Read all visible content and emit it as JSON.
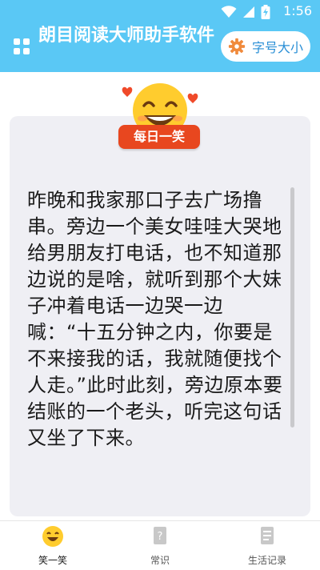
{
  "status_bar": {
    "time": "1:56",
    "battery_icon": "battery-charging-icon",
    "wifi_icon": "wifi-icon",
    "signal_icon": "signal-icon"
  },
  "header": {
    "menu_icon": "grid-menu-icon",
    "title": "朗目阅读大师助手软件",
    "font_size_button": {
      "icon": "gear-icon",
      "label": "字号大小"
    }
  },
  "joke_card": {
    "badge": "每日一笑",
    "emoji_icon": "laughing-face-icon",
    "text": "昨晚和我家那口子去广场撸串。旁边一个美女哇哇大哭地给男朋友打电话，也不知道那边说的是啥，就听到那个大妹子冲着电话一边哭一边喊：“十五分钟之内，你要是不来接我的话，我就随便找个人走。”此时此刻，旁边原本要结账的一个老头，听完这句话又坐了下来。"
  },
  "bottom_nav": {
    "items": [
      {
        "label": "笑一笑",
        "icon": "smile-face-icon",
        "active": true
      },
      {
        "label": "常识",
        "icon": "question-note-icon",
        "active": false
      },
      {
        "label": "生活记录",
        "icon": "notes-icon",
        "active": false
      }
    ]
  },
  "colors": {
    "header_bg": "#5ac8f5",
    "badge_bg": "#e8471f",
    "card_bg": "#efeff4",
    "accent_text": "#2a8fd6"
  }
}
